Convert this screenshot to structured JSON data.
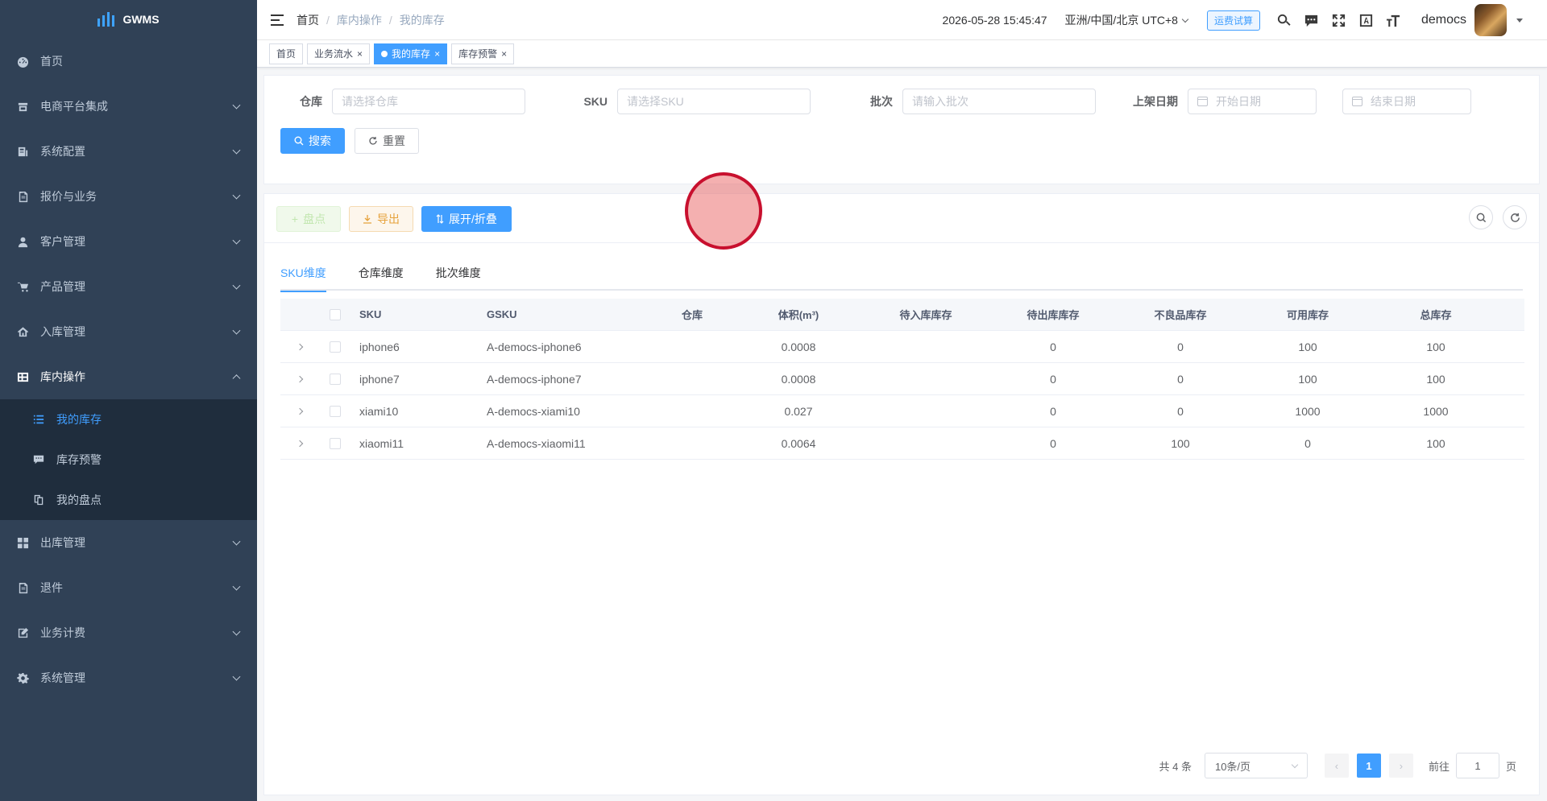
{
  "app": {
    "name": "GWMS"
  },
  "sidebar": {
    "items": [
      {
        "label": "首页",
        "icon": "dashboard-icon"
      },
      {
        "label": "电商平台集成",
        "icon": "store-icon"
      },
      {
        "label": "系统配置",
        "icon": "config-icon"
      },
      {
        "label": "报价与业务",
        "icon": "quote-icon"
      },
      {
        "label": "客户管理",
        "icon": "user-icon"
      },
      {
        "label": "产品管理",
        "icon": "cart-icon"
      },
      {
        "label": "入库管理",
        "icon": "home-icon"
      },
      {
        "label": "库内操作",
        "icon": "grid-icon"
      },
      {
        "label": "出库管理",
        "icon": "apps-icon"
      },
      {
        "label": "退件",
        "icon": "return-icon"
      },
      {
        "label": "业务计费",
        "icon": "edit-icon"
      },
      {
        "label": "系统管理",
        "icon": "gear-icon"
      }
    ],
    "sub_items": [
      {
        "label": "我的库存",
        "icon": "list-icon"
      },
      {
        "label": "库存预警",
        "icon": "message-icon"
      },
      {
        "label": "我的盘点",
        "icon": "copy-icon"
      }
    ]
  },
  "navbar": {
    "breadcrumb": [
      "首页",
      "库内操作",
      "我的库存"
    ],
    "datetime": "2026-05-28 15:45:47",
    "timezone": "亚洲/中国/北京 UTC+8",
    "freight_button": "运费试算",
    "user": "democs"
  },
  "tags": [
    {
      "label": "首页"
    },
    {
      "label": "业务流水"
    },
    {
      "label": "我的库存"
    },
    {
      "label": "库存预警"
    }
  ],
  "search": {
    "warehouse_label": "仓库",
    "warehouse_placeholder": "请选择仓库",
    "sku_label": "SKU",
    "sku_placeholder": "请选择SKU",
    "batch_label": "批次",
    "batch_placeholder": "请输入批次",
    "date_label": "上架日期",
    "start_placeholder": "开始日期",
    "end_placeholder": "结束日期",
    "search_button": "搜索",
    "reset_button": "重置"
  },
  "toolbar": {
    "stocktake_button": "盘点",
    "export_button": "导出",
    "expand_button": "展开/折叠"
  },
  "tabs": [
    "SKU维度",
    "仓库维度",
    "批次维度"
  ],
  "table": {
    "headers": {
      "sku": "SKU",
      "gsku": "GSKU",
      "warehouse": "仓库",
      "volume": "体积(m³)",
      "pending_in": "待入库库存",
      "pending_out": "待出库库存",
      "defective": "不良品库存",
      "available": "可用库存",
      "total": "总库存"
    },
    "rows": [
      {
        "sku": "iphone6",
        "gsku": "A-democs-iphone6",
        "warehouse": "",
        "volume": "0.0008",
        "pending_in": "",
        "pending_out": "0",
        "defective": "0",
        "available": "100",
        "total": "100"
      },
      {
        "sku": "iphone7",
        "gsku": "A-democs-iphone7",
        "warehouse": "",
        "volume": "0.0008",
        "pending_in": "",
        "pending_out": "0",
        "defective": "0",
        "available": "100",
        "total": "100"
      },
      {
        "sku": "xiami10",
        "gsku": "A-democs-xiami10",
        "warehouse": "",
        "volume": "0.027",
        "pending_in": "",
        "pending_out": "0",
        "defective": "0",
        "available": "1000",
        "total": "1000"
      },
      {
        "sku": "xiaomi11",
        "gsku": "A-democs-xiaomi11",
        "warehouse": "",
        "volume": "0.0064",
        "pending_in": "",
        "pending_out": "0",
        "defective": "100",
        "available": "0",
        "total": "100"
      }
    ]
  },
  "pagination": {
    "total": "共 4 条",
    "page_size": "10条/页",
    "current_page": "1",
    "goto_prefix": "前往",
    "goto_value": "1",
    "goto_suffix": "页"
  },
  "colors": {
    "sidebar_bg": "#304156",
    "primary": "#409eff",
    "highlight": "#c8102e"
  }
}
